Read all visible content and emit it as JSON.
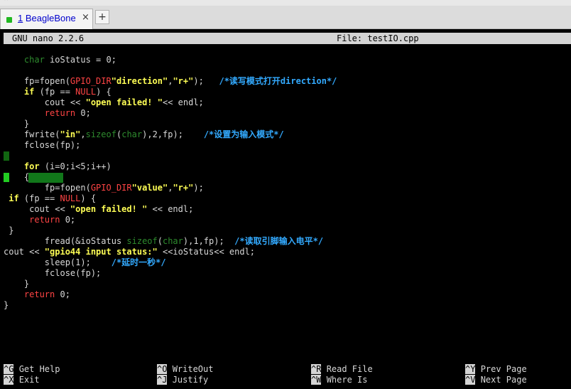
{
  "tabs": [
    {
      "number": "1",
      "label": "BeagleBone",
      "close": "×"
    }
  ],
  "new_tab": "+",
  "nano": {
    "version": "GNU nano 2.2.6",
    "file": "File: testIO.cpp"
  },
  "code": {
    "l1": {
      "a": "    ",
      "b": "char",
      "c": " ioStatus = 0;"
    },
    "l2": {
      "a": "    fp=fopen(",
      "b": "GPIO_DIR",
      "c": "\"direction\"",
      "d": ",",
      "e": "\"r+\"",
      "f": ");   ",
      "g": "/*读写模式打开direction*/"
    },
    "l3": {
      "a": "    ",
      "b": "if",
      "c": " (fp == ",
      "d": "NULL",
      "e": ") {"
    },
    "l4": {
      "a": "        cout << ",
      "b": "\"open failed! \"",
      "c": "<< endl;"
    },
    "l5": {
      "a": "        ",
      "b": "return",
      "c": " 0;"
    },
    "l6": {
      "a": "    }"
    },
    "l7": {
      "a": "    fwrite(",
      "b": "\"in\"",
      "c": ",",
      "d": "sizeof",
      "e": "(",
      "f": "char",
      "g": "),2,fp);    ",
      "h": "/*设置为输入模式*/"
    },
    "l8": {
      "a": "    fclose(fp);"
    },
    "l9": {
      "a": "    ",
      "b": "for",
      "c": " (i=0;i<5;i++)"
    },
    "l10": {
      "a": "    {"
    },
    "l11": {
      "a": "        fp=fopen(",
      "b": "GPIO_DIR",
      "c": "\"value\"",
      "d": ",",
      "e": "\"r+\"",
      "f": ");"
    },
    "l12": {
      "a": " ",
      "b": "if",
      "c": " (fp == ",
      "d": "NULL",
      "e": ") {"
    },
    "l13": {
      "a": "     cout << ",
      "b": "\"open failed! \"",
      "c": " << endl;"
    },
    "l14": {
      "a": "     ",
      "b": "return",
      "c": " 0;"
    },
    "l15": {
      "a": " }"
    },
    "l16": {
      "a": "        fread(&ioStatus ",
      "b": "sizeof",
      "c": "(",
      "d": "char",
      "e": "),1,fp);  ",
      "f": "/*读取引脚输入电平*/"
    },
    "l17": {
      "a": "cout << ",
      "b": "\"gpio44 input status:\"",
      "c": " <<ioStatus<< endl;"
    },
    "l18": {
      "a": "        sleep(1);    ",
      "b": "/*延时一秒*/"
    },
    "l19": {
      "a": "        fclose(fp);"
    },
    "l20": {
      "a": "    }"
    },
    "l21": {
      "a": "    ",
      "b": "return",
      "c": " 0;"
    },
    "l22": {
      "a": "}"
    }
  },
  "shortcuts": [
    {
      "key": "^G",
      "label": "Get Help"
    },
    {
      "key": "^O",
      "label": "WriteOut"
    },
    {
      "key": "^R",
      "label": "Read File"
    },
    {
      "key": "^Y",
      "label": "Prev Page"
    },
    {
      "key": "^X",
      "label": "Exit"
    },
    {
      "key": "^J",
      "label": "Justify"
    },
    {
      "key": "^W",
      "label": "Where Is"
    },
    {
      "key": "^V",
      "label": "Next Page"
    }
  ]
}
